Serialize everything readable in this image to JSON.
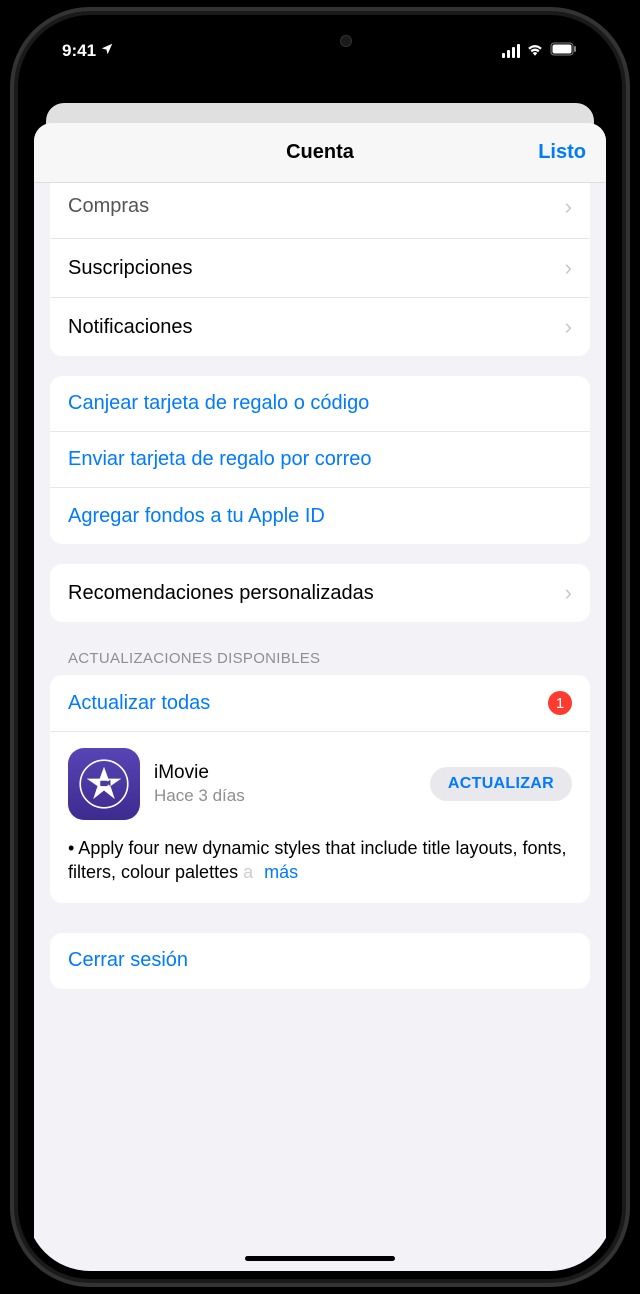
{
  "status_bar": {
    "time": "9:41"
  },
  "nav": {
    "title": "Cuenta",
    "done": "Listo"
  },
  "section1": {
    "compras": "Compras",
    "suscripciones": "Suscripciones",
    "notificaciones": "Notificaciones"
  },
  "section2": {
    "canjear": "Canjear tarjeta de regalo o código",
    "enviar": "Enviar tarjeta de regalo por correo",
    "agregar": "Agregar fondos a tu Apple ID"
  },
  "section3": {
    "recomendaciones": "Recomendaciones personalizadas"
  },
  "updates": {
    "header": "ACTUALIZACIONES DISPONIBLES",
    "update_all": "Actualizar todas",
    "badge": "1",
    "app": {
      "name": "iMovie",
      "time": "Hace 3 días",
      "button": "ACTUALIZAR",
      "notes_prefix": "• Apply four new dynamic styles that include title layouts, fonts, filters, colour palettes ",
      "notes_fade": "a",
      "more": "más"
    }
  },
  "footer": {
    "signout": "Cerrar sesión"
  }
}
